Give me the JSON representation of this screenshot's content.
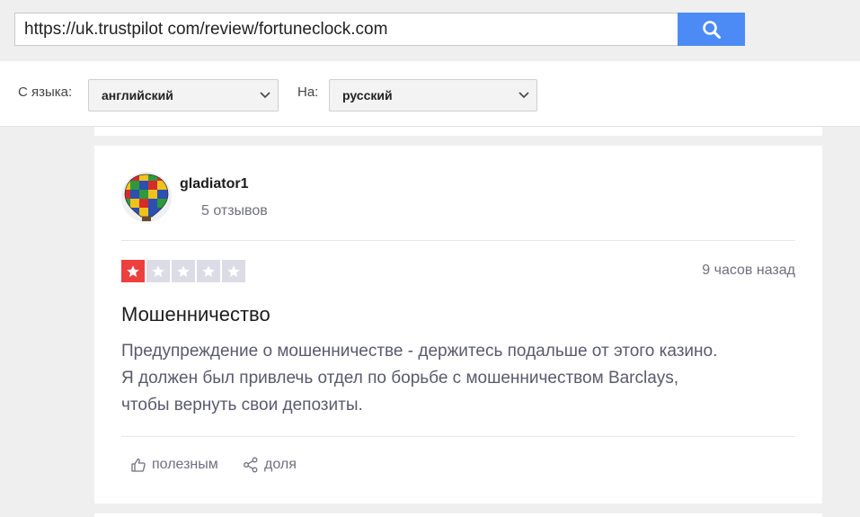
{
  "search": {
    "url_value": "https://uk.trustpilot com/review/fortuneclock.com",
    "button_icon": "search-icon"
  },
  "translate": {
    "from_label": "С языка:",
    "from_value": "английский",
    "to_label": "На:",
    "to_value": "русский"
  },
  "review": {
    "username": "gladiator1",
    "review_count": "5 отзывов",
    "rating": 1,
    "rating_max": 5,
    "time_ago": "9 часов назад",
    "title": "Мошенничество",
    "lines": [
      "Предупреждение о мошенничестве - держитесь подальше от этого казино.",
      "Я должен был привлечь отдел по борьбе с мошенничеством Barclays,",
      "чтобы вернуть свои депозиты."
    ],
    "useful_label": "полезным",
    "share_label": "доля"
  },
  "colors": {
    "accent_blue": "#4c8bf5",
    "star_red": "#ee3f3f",
    "star_empty": "#dcdce6"
  }
}
